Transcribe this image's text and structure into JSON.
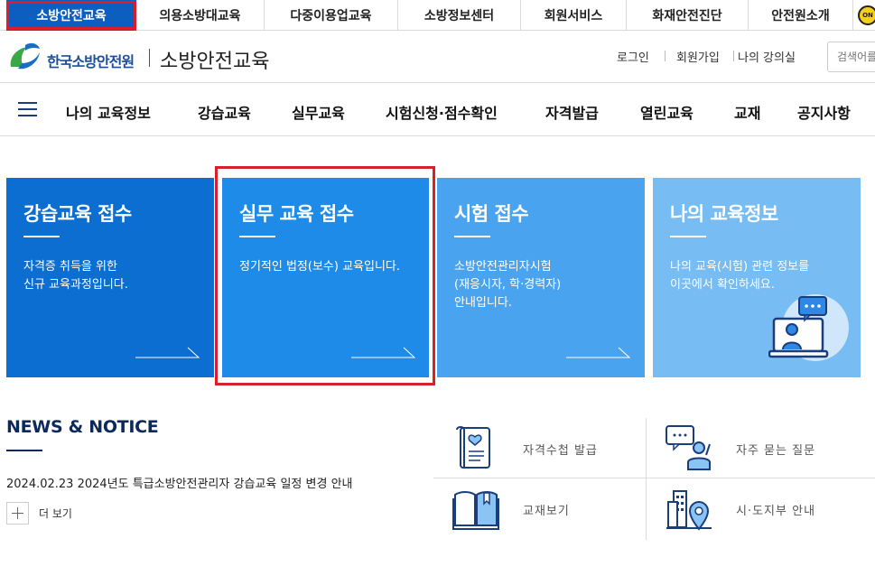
{
  "top_sites": [
    {
      "label": "소방안전교육",
      "active": true
    },
    {
      "label": "의용소방대교육",
      "active": false
    },
    {
      "label": "다중이용업교육",
      "active": false
    },
    {
      "label": "소방정보센터",
      "active": false
    },
    {
      "label": "회원서비스",
      "active": false
    },
    {
      "label": "화재안전진단",
      "active": false
    },
    {
      "label": "안전원소개",
      "active": false
    }
  ],
  "header": {
    "org_name": "한국소방안전원",
    "site_name": "소방안전교육",
    "util_links": [
      "로그인",
      "회원가입",
      "나의 강의실"
    ],
    "search_placeholder": "검색어를"
  },
  "gnb": {
    "menu_icon": "hamburger-icon",
    "items": [
      "나의 교육정보",
      "강습교육",
      "실무교육",
      "시험신청·점수확인",
      "자격발급",
      "열린교육",
      "교재",
      "공지사항"
    ]
  },
  "cards": [
    {
      "title": "강습교육 접수",
      "desc": [
        "자격증 취득을 위한",
        "신규 교육과정입니다."
      ],
      "color": "#0b6ed0"
    },
    {
      "title": "실무 교육 접수",
      "desc": [
        "정기적인 법정(보수) 교육입니다."
      ],
      "color": "#1e8be8",
      "highlighted": true
    },
    {
      "title": "시험 접수",
      "desc": [
        "소방안전관리자시험",
        "(재응시자, 학·경력자)",
        "안내입니다."
      ],
      "color": "#4aa3ef"
    },
    {
      "title": "나의 교육정보",
      "desc": [
        "나의 교육(시험) 관련 정보를",
        "이곳에서 확인하세요."
      ],
      "color": "#77bcf3"
    }
  ],
  "news": {
    "title": "NEWS & NOTICE",
    "items": [
      {
        "date": "2024.02.23",
        "text": "2024년도 특급소방안전관리자 강습교육 일정 변경 안내"
      }
    ],
    "more_label": "더 보기"
  },
  "quick_links": [
    {
      "label": "자격수첩 발급",
      "icon": "certificate-icon"
    },
    {
      "label": "자주 묻는 질문",
      "icon": "faq-icon"
    },
    {
      "label": "교재보기",
      "icon": "book-icon"
    },
    {
      "label": "시·도지부 안내",
      "icon": "location-building-icon"
    }
  ],
  "colors": {
    "brand_blue": "#0c5fbf",
    "highlight_red": "#d9202a",
    "navy": "#0b2a5b"
  }
}
